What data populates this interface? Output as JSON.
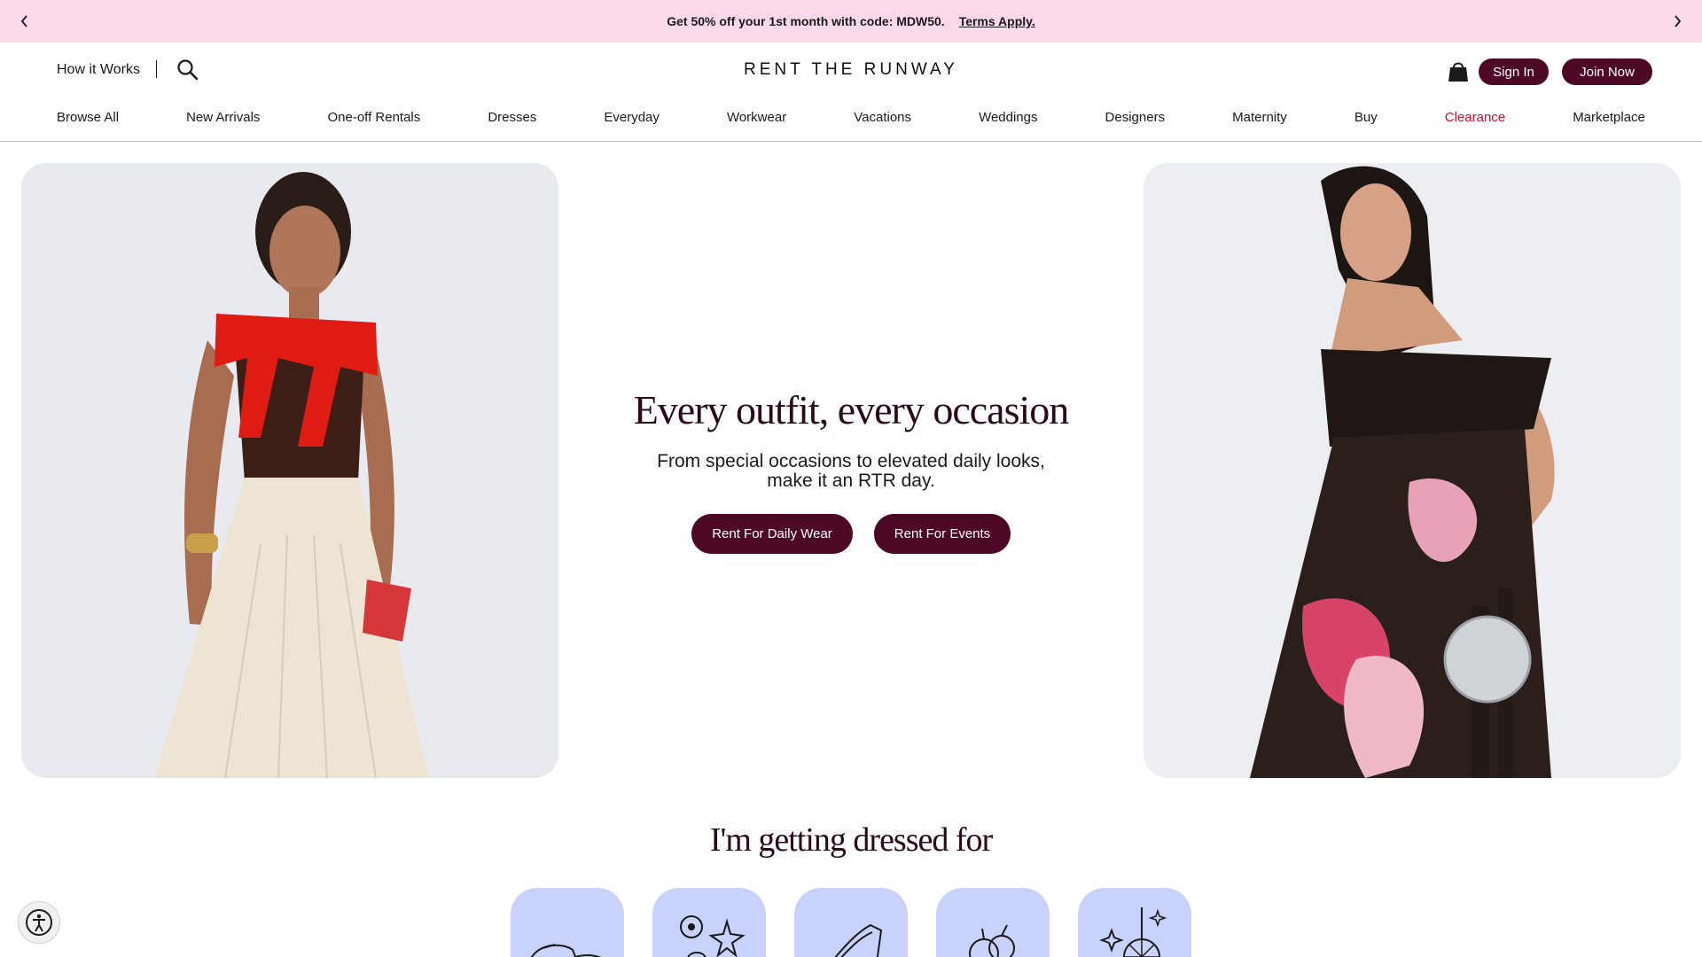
{
  "promo": {
    "text": "Get 50% off your 1st month with code: MDW50.",
    "link": "Terms Apply.",
    "background": "#fcd9ea"
  },
  "header": {
    "how_it_works": "How it Works",
    "logo": "RENT THE RUNWAY",
    "sign_in": "Sign In",
    "join_now": "Join Now",
    "icons": [
      "search-icon",
      "shopping-bag-icon"
    ]
  },
  "nav": {
    "items": [
      "Browse All",
      "New Arrivals",
      "One-off Rentals",
      "Dresses",
      "Everyday",
      "Workwear",
      "Vacations",
      "Weddings",
      "Designers",
      "Maternity",
      "Buy",
      "Clearance",
      "Marketplace"
    ]
  },
  "hero": {
    "title": "Every outfit, every occasion",
    "subtitle_line1": "From special occasions to elevated daily looks,",
    "subtitle_line2": "make it an RTR day.",
    "button_daily": "Rent For Daily Wear",
    "button_events": "Rent For Events"
  },
  "dressed": {
    "title": "I'm getting dressed for",
    "tiles": [
      "loafers-icon",
      "tropical-vacation-icon",
      "high-heel-icon",
      "fruit-icon",
      "disco-ball-icon"
    ]
  },
  "colors": {
    "brand": "#4d0826",
    "sale": "#c8102e",
    "tile": "#c8d2fb"
  }
}
